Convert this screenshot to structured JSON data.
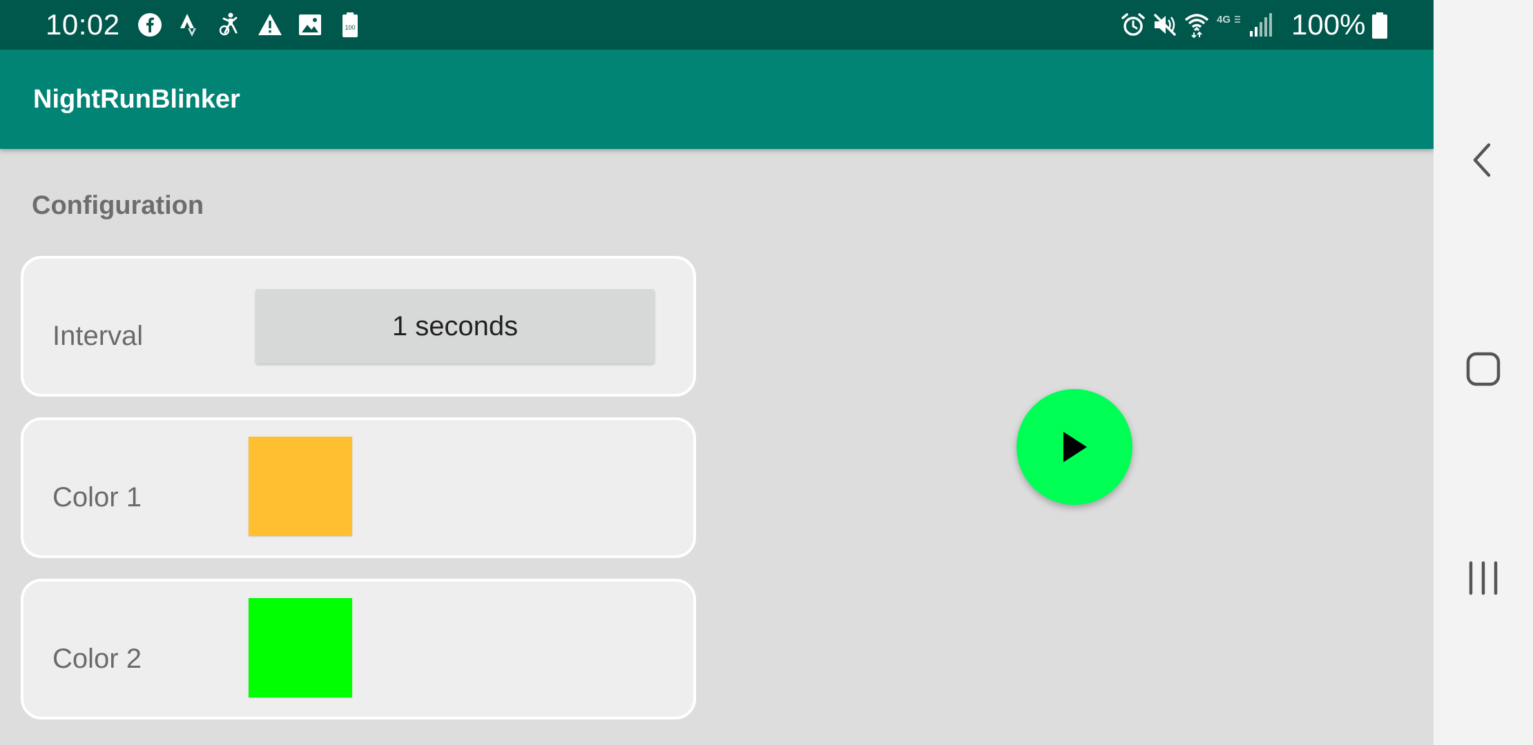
{
  "status_bar": {
    "time": "10:02",
    "battery_percent": "100%",
    "left_icons": [
      "facebook-icon",
      "strava-icon",
      "accessibility-icon",
      "warning-icon",
      "image-icon",
      "battery-saver-icon"
    ],
    "right_icons": [
      "alarm-icon",
      "mute-icon",
      "wifi-icon",
      "lte-icon",
      "signal-icon"
    ],
    "battery_saver_text": "100",
    "network_text": "4G",
    "background": "#00574b"
  },
  "app_bar": {
    "title": "NightRunBlinker",
    "background": "#028474"
  },
  "config": {
    "section_title": "Configuration",
    "interval": {
      "label": "Interval",
      "value": "1 seconds"
    },
    "color1": {
      "label": "Color 1",
      "color": "#ffbf30"
    },
    "color2": {
      "label": "Color 2",
      "color": "#00ff00"
    }
  },
  "fab": {
    "icon": "play-icon",
    "color": "#00ff55"
  },
  "nav_bar": {
    "buttons": [
      "back-icon",
      "home-icon",
      "recents-icon"
    ]
  }
}
